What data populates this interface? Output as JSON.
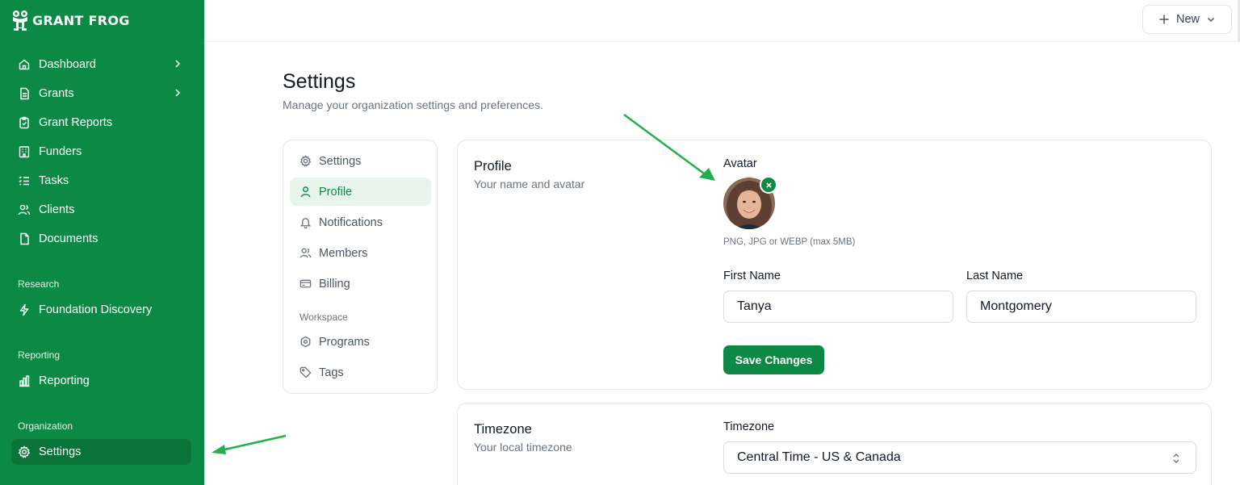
{
  "brand": {
    "name": "GRANT FROG",
    "accent": "#0c8a45"
  },
  "sidebar": {
    "items": [
      {
        "label": "Dashboard",
        "icon": "home-icon",
        "has_chevron": true
      },
      {
        "label": "Grants",
        "icon": "file-icon",
        "has_chevron": true
      },
      {
        "label": "Grant Reports",
        "icon": "clipboard-icon",
        "has_chevron": false
      },
      {
        "label": "Funders",
        "icon": "building-icon",
        "has_chevron": false
      },
      {
        "label": "Tasks",
        "icon": "list-checks-icon",
        "has_chevron": false
      },
      {
        "label": "Clients",
        "icon": "users-icon",
        "has_chevron": false
      },
      {
        "label": "Documents",
        "icon": "document-icon",
        "has_chevron": false
      }
    ],
    "sections": {
      "research": {
        "title": "Research",
        "items": [
          {
            "label": "Foundation Discovery",
            "icon": "lightning-icon"
          }
        ]
      },
      "reporting": {
        "title": "Reporting",
        "items": [
          {
            "label": "Reporting",
            "icon": "bar-chart-icon"
          }
        ]
      },
      "organization": {
        "title": "Organization",
        "items": [
          {
            "label": "Settings",
            "icon": "gear-icon",
            "active": true
          }
        ]
      }
    }
  },
  "topbar": {
    "new_label": "New"
  },
  "page": {
    "title": "Settings",
    "subtitle": "Manage your organization settings and preferences."
  },
  "settings_nav": {
    "items": [
      {
        "label": "Settings",
        "icon": "gear-icon",
        "active": false
      },
      {
        "label": "Profile",
        "icon": "user-icon",
        "active": true
      },
      {
        "label": "Notifications",
        "icon": "bell-icon",
        "active": false
      },
      {
        "label": "Members",
        "icon": "users-icon",
        "active": false
      },
      {
        "label": "Billing",
        "icon": "credit-card-icon",
        "active": false
      }
    ],
    "workspace_title": "Workspace",
    "workspace_items": [
      {
        "label": "Programs",
        "icon": "hexagon-icon"
      },
      {
        "label": "Tags",
        "icon": "tag-icon"
      }
    ]
  },
  "profile_card": {
    "title": "Profile",
    "subtitle": "Your name and avatar",
    "avatar_label": "Avatar",
    "avatar_hint": "PNG, JPG or WEBP (max 5MB)",
    "first_name_label": "First Name",
    "first_name_value": "Tanya",
    "last_name_label": "Last Name",
    "last_name_value": "Montgomery",
    "save_label": "Save Changes"
  },
  "timezone_card": {
    "title": "Timezone",
    "subtitle": "Your local timezone",
    "field_label": "Timezone",
    "selected": "Central Time - US & Canada"
  }
}
